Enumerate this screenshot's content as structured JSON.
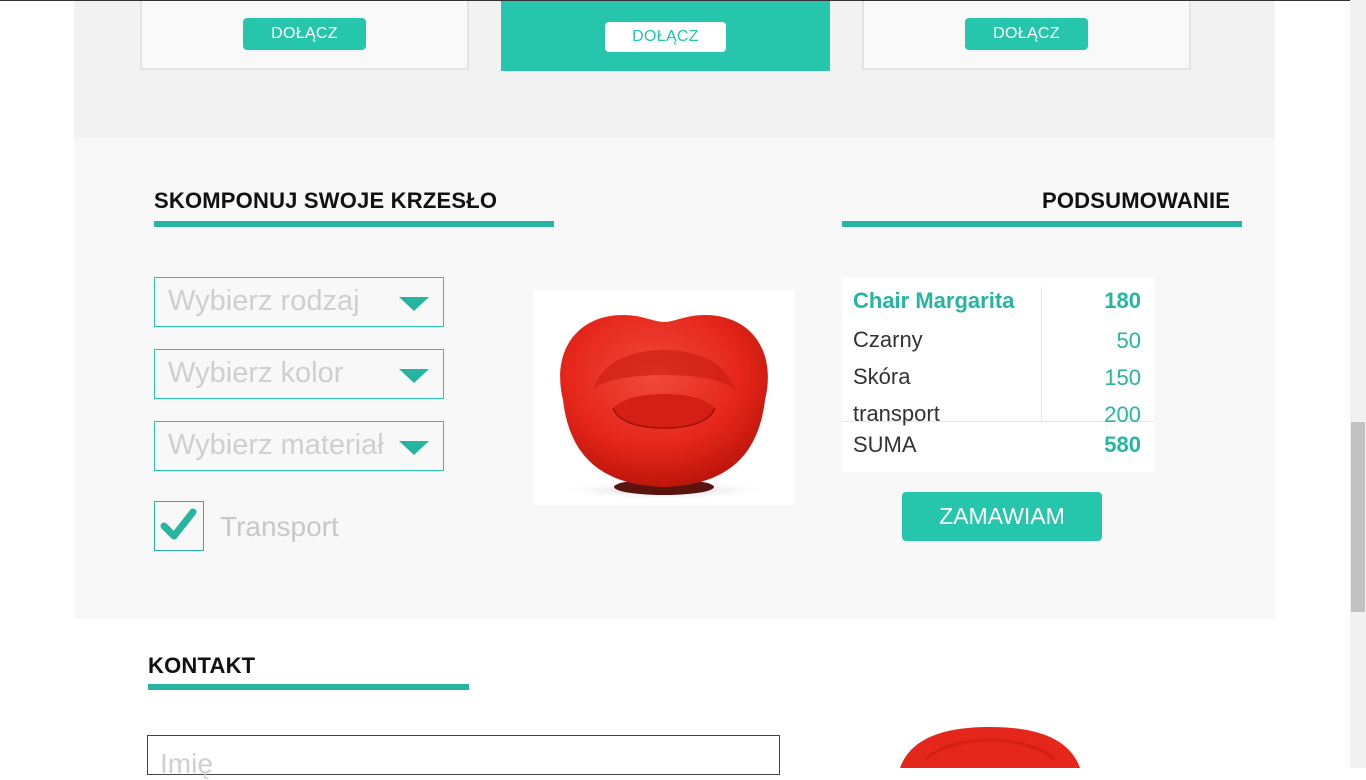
{
  "pricing": {
    "plans": [
      {
        "join_label": "DOŁĄCZ"
      },
      {
        "join_label": "DOŁĄCZ"
      },
      {
        "join_label": "DOŁĄCZ"
      }
    ]
  },
  "configurator": {
    "title": "SKOMPONUJ SWOJE KRZESŁO",
    "selects": [
      {
        "placeholder": "Wybierz rodzaj"
      },
      {
        "placeholder": "Wybierz kolor"
      },
      {
        "placeholder": "Wybierz materiał"
      }
    ],
    "transport_label": "Transport",
    "transport_checked": true
  },
  "summary": {
    "title": "PODSUMOWANIE",
    "product_name": "Chair Margarita",
    "product_price": "180",
    "rows": [
      {
        "name": "Czarny",
        "value": "50"
      },
      {
        "name": "Skóra",
        "value": "150"
      },
      {
        "name": "transport",
        "value": "200"
      }
    ],
    "total_label": "SUMA",
    "total_value": "580",
    "order_label": "ZAMAWIAM"
  },
  "contact": {
    "title": "KONTAKT",
    "name_placeholder": "Imię"
  },
  "colors": {
    "accent": "#26c6ad",
    "chair": "#e8291c"
  }
}
